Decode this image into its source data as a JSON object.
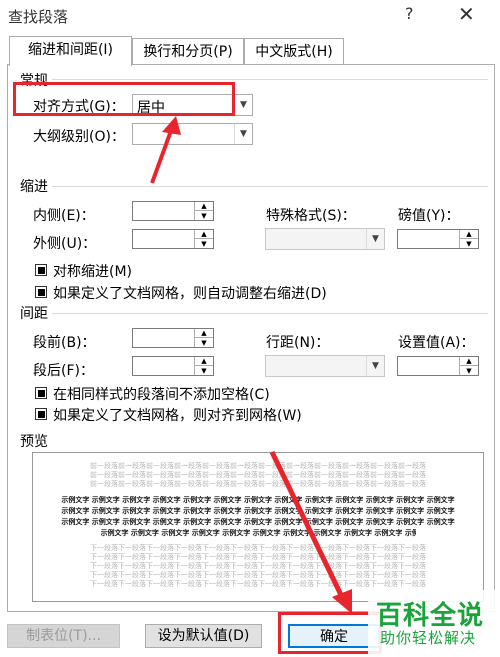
{
  "window": {
    "title": "查找段落",
    "help_glyph": "?",
    "close_glyph": "✕"
  },
  "tabs": [
    {
      "label": "缩进和间距(I)",
      "active": true
    },
    {
      "label": "换行和分页(P)",
      "active": false
    },
    {
      "label": "中文版式(H)",
      "active": false
    }
  ],
  "general": {
    "group_label": "常规",
    "alignment_label": "对齐方式(G)：",
    "alignment_value": "居中",
    "outline_label": "大纲级别(O)：",
    "outline_value": ""
  },
  "indent": {
    "group_label": "缩进",
    "inner_label": "内侧(E)：",
    "outer_label": "外侧(U)：",
    "special_label": "特殊格式(S)：",
    "pounds_label": "磅值(Y)：",
    "mirror_label": "对称缩进(M)",
    "mirror_checked": true,
    "auto_adjust_label": "如果定义了文档网格，则自动调整右缩进(D)",
    "auto_adjust_checked": true
  },
  "spacing": {
    "group_label": "间距",
    "before_label": "段前(B)：",
    "after_label": "段后(F)：",
    "line_spacing_label": "行距(N)：",
    "set_value_label": "设置值(A)：",
    "no_space_label": "在相同样式的段落间不添加空格(C)",
    "no_space_checked": true,
    "snap_grid_label": "如果定义了文档网格，则对齐到网格(W)",
    "snap_grid_checked": true
  },
  "preview": {
    "group_label": "预览",
    "prev_text": "前一段落前一段落前一段落前一段落前一段落前一段落前一段落前一段落前一段落前一段落前一段落前一段落",
    "sample_text": "示例文字 示例文字 示例文字 示例文字 示例文字 示例文字 示例文字 示例文字 示例文字 示例文字 示例文字 示例文字 示例文字",
    "next_text": "下一段落下一段落下一段落下一段落下一段落下一段落下一段落下一段落下一段落下一段落下一段落下一段落"
  },
  "buttons": {
    "tabs_label": "制表位(T)...",
    "default_label": "设为默认值(D)",
    "ok_label": "确定"
  },
  "watermark": {
    "main": "百科全说",
    "sub": "助你轻松解决"
  },
  "colors": {
    "annotation_red": "#e8242d",
    "watermark_green": "#1aa33b"
  }
}
